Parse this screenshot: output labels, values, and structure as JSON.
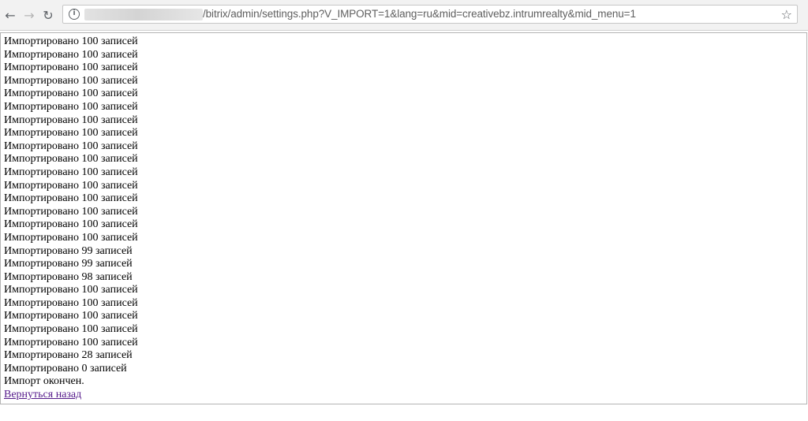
{
  "browser": {
    "url": "/bitrix/admin/settings.php?V_IMPORT=1&lang=ru&mid=creativebz.intrumrealty&mid_menu=1"
  },
  "page": {
    "lines": [
      "Импортировано 100 записей",
      "Импортировано 100 записей",
      "Импортировано 100 записей",
      "Импортировано 100 записей",
      "Импортировано 100 записей",
      "Импортировано 100 записей",
      "Импортировано 100 записей",
      "Импортировано 100 записей",
      "Импортировано 100 записей",
      "Импортировано 100 записей",
      "Импортировано 100 записей",
      "Импортировано 100 записей",
      "Импортировано 100 записей",
      "Импортировано 100 записей",
      "Импортировано 100 записей",
      "Импортировано 100 записей",
      "Импортировано 99 записей",
      "Импортировано 99 записей",
      "Импортировано 98 записей",
      "Импортировано 100 записей",
      "Импортировано 100 записей",
      "Импортировано 100 записей",
      "Импортировано 100 записей",
      "Импортировано 100 записей",
      "Импортировано 28 записей",
      "Импортировано 0 записей",
      "Импорт окончен."
    ],
    "back_link": "Вернуться назад"
  }
}
